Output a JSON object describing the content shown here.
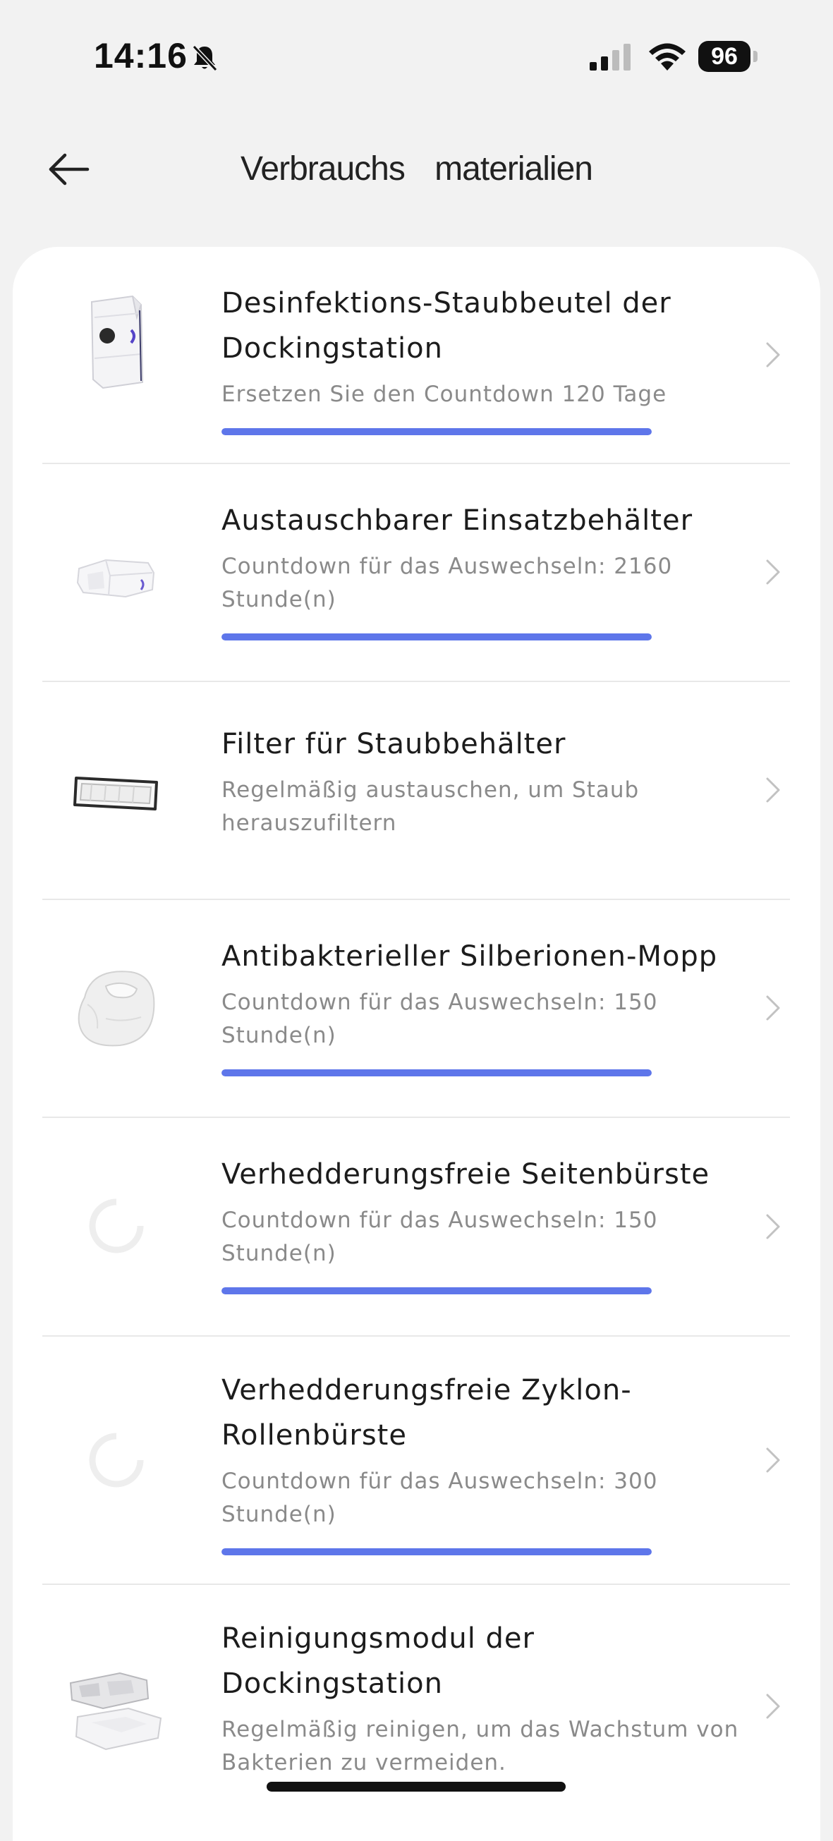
{
  "status_bar": {
    "time": "14:16",
    "battery": "96"
  },
  "header": {
    "title": "Verbrauchs materialien"
  },
  "items": [
    {
      "title": "Desinfektions-Staubbeutel der Dockingstation",
      "subtitle": "Ersetzen Sie den Countdown 120 Tage",
      "progress": 1.0,
      "image": "dust-bag-image"
    },
    {
      "title": "Austauschbarer Einsatzbehälter",
      "subtitle": "Countdown für das Auswechseln: 2160 Stunde(n)",
      "progress": 1.0,
      "image": "container-image"
    },
    {
      "title": "Filter für Staubbehälter",
      "subtitle": "Regelmäßig austauschen, um Staub herauszufiltern",
      "image": "filter-image"
    },
    {
      "title": "Antibakterieller Silberionen-Mopp",
      "subtitle": "Countdown für das Auswechseln: 150 Stunde(n)",
      "progress": 1.0,
      "image": "mop-image"
    },
    {
      "title": "Verhedderungsfreie Seitenbürste",
      "subtitle": "Countdown für das Auswechseln: 150 Stunde(n)",
      "progress": 1.0,
      "image": "loading-spinner-icon"
    },
    {
      "title": "Verhedderungsfreie Zyklon-Rollenbürste",
      "subtitle": "Countdown für das Auswechseln: 300 Stunde(n)",
      "progress": 1.0,
      "image": "loading-spinner-icon"
    },
    {
      "title": "Reinigungsmodul der Dockingstation",
      "subtitle": "Regelmäßig reinigen, um das Wachstum von Bakterien zu vermeiden.",
      "image": "cleaning-module-image"
    }
  ],
  "colors": {
    "accent": "#5e76ea",
    "background": "#f2f2f2",
    "card": "#ffffff"
  }
}
